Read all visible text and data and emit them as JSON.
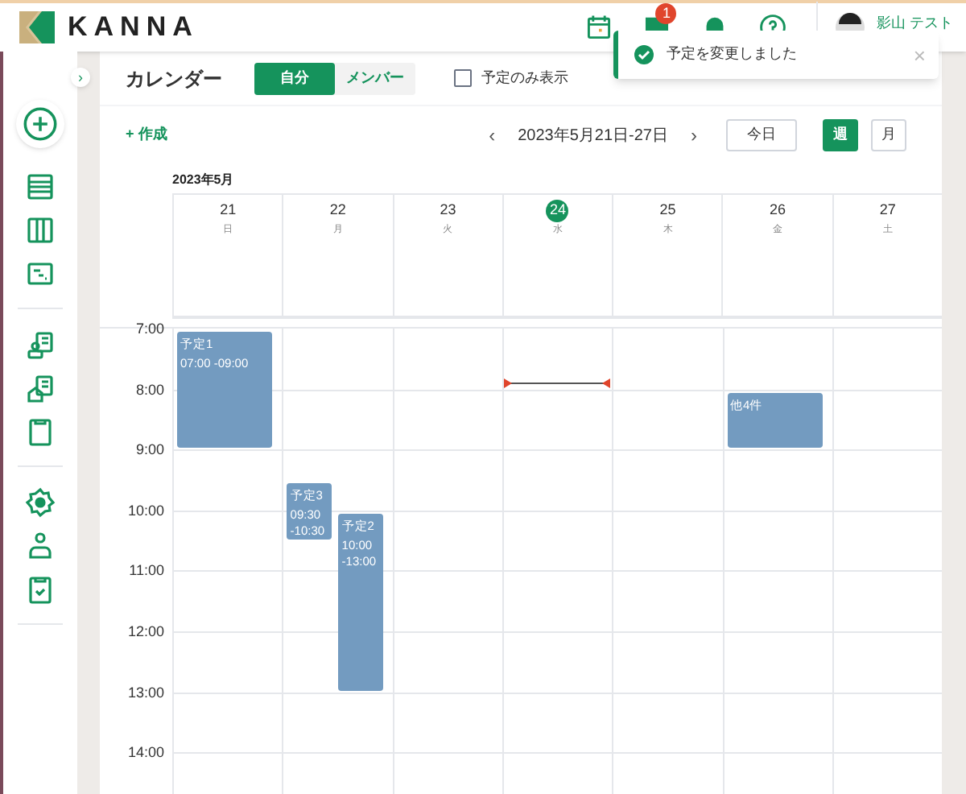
{
  "brand": "KANNA",
  "header": {
    "badge": "1",
    "user": "影山 テスト"
  },
  "toast": {
    "message": "予定を変更しました",
    "close": "×"
  },
  "sidebar": {
    "expand": "›"
  },
  "page": {
    "title": "カレンダー",
    "segments": [
      {
        "label": "自分",
        "selected": true
      },
      {
        "label": "メンバー",
        "selected": false
      }
    ],
    "filter": {
      "label": "予定のみ表示",
      "checked": false
    }
  },
  "toolbar": {
    "create": "+ 作成",
    "prev": "‹",
    "range": "2023年5月21日-27日",
    "next": "›",
    "today": "今日",
    "views": [
      {
        "label": "週",
        "selected": true
      },
      {
        "label": "月",
        "selected": false
      }
    ]
  },
  "month": "2023年5月",
  "days": [
    {
      "date": "21",
      "weekday": "日",
      "today": false,
      "events": [
        {
          "kind": "event",
          "title": "予定1",
          "time": "07:00 -09:00"
        }
      ]
    },
    {
      "date": "22",
      "weekday": "月",
      "today": false,
      "events": [
        {
          "kind": "event",
          "title": "予定3",
          "time": "09:30 -10:30"
        },
        {
          "kind": "event",
          "title": "予定2",
          "time": "10:00 -13:00"
        }
      ]
    },
    {
      "date": "23",
      "weekday": "火",
      "today": false
    },
    {
      "date": "24",
      "weekday": "水",
      "today": true
    },
    {
      "date": "25",
      "weekday": "木",
      "today": false
    },
    {
      "date": "26",
      "weekday": "金",
      "today": false,
      "events": [
        {
          "kind": "more",
          "title": "他4件"
        }
      ]
    },
    {
      "date": "27",
      "weekday": "土",
      "today": false
    }
  ],
  "hours": [
    "7:00",
    "8:00",
    "9:00",
    "10:00",
    "11:00",
    "12:00",
    "13:00",
    "14:00"
  ]
}
